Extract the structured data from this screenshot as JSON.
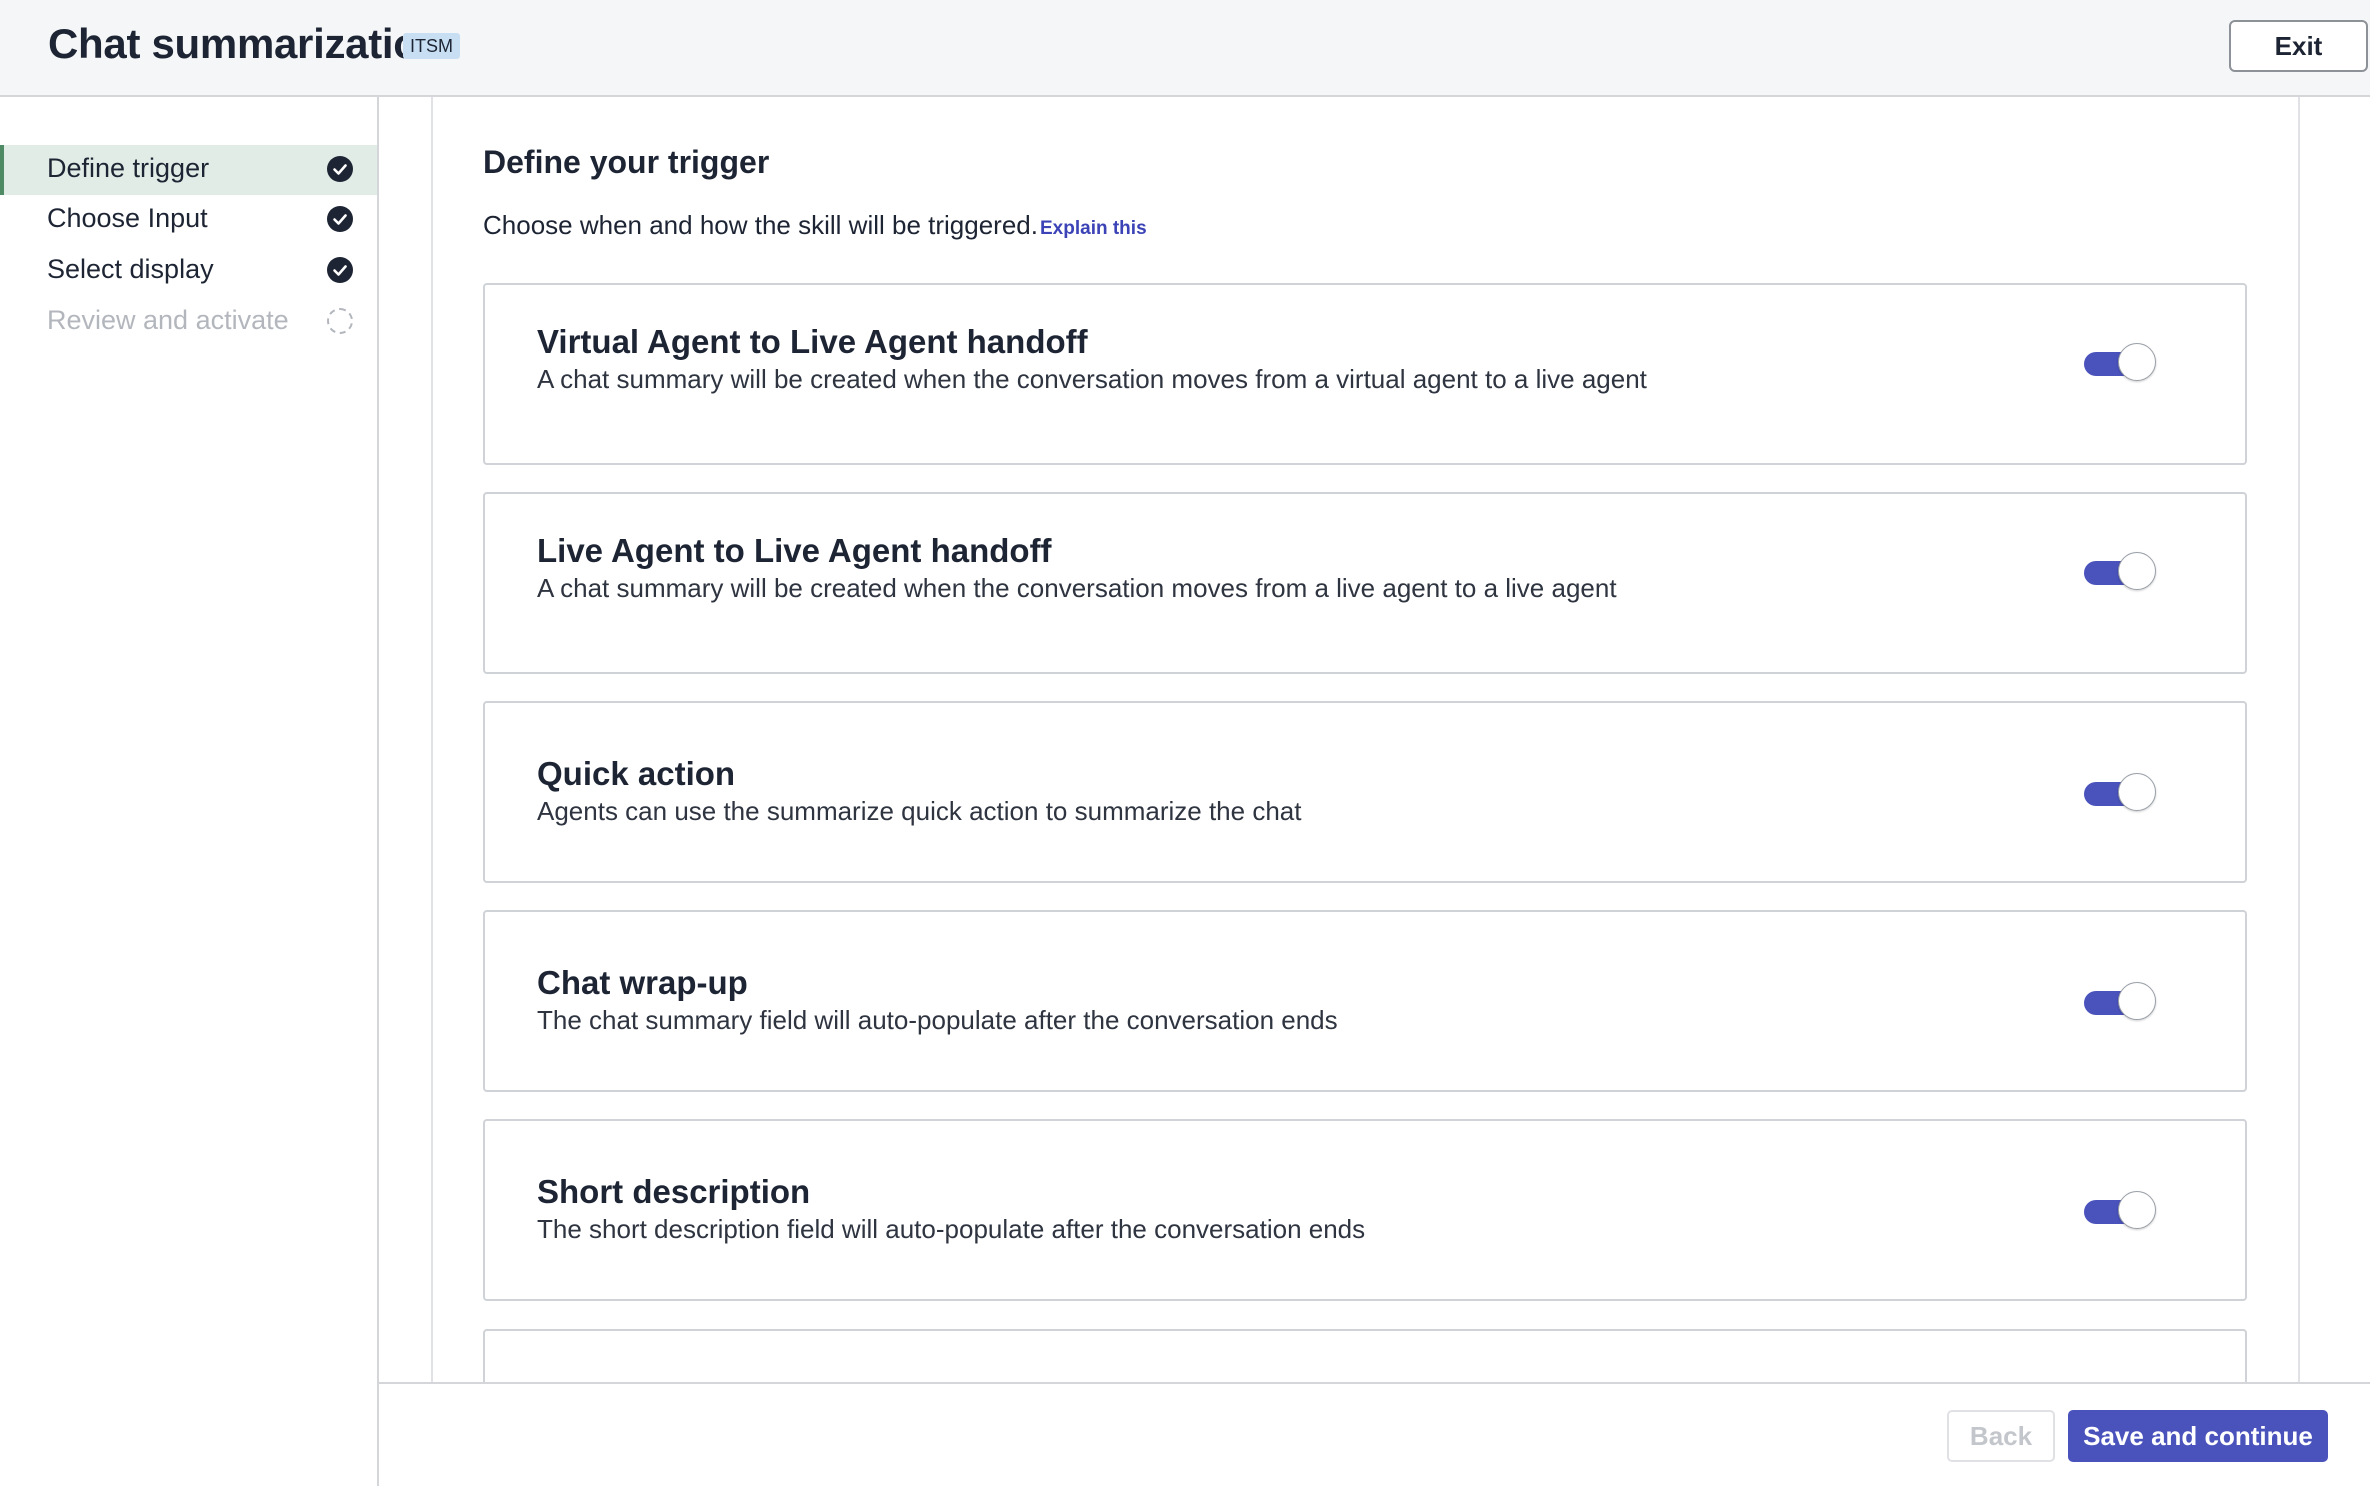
{
  "header": {
    "title": "Chat summarization",
    "badge": "ITSM",
    "exit_label": "Exit"
  },
  "sidebar": {
    "steps": [
      {
        "label": "Define trigger",
        "status": "complete",
        "active": true
      },
      {
        "label": "Choose Input",
        "status": "complete",
        "active": false
      },
      {
        "label": "Select display",
        "status": "complete",
        "active": false
      },
      {
        "label": "Review and activate",
        "status": "pending",
        "active": false
      }
    ]
  },
  "main": {
    "title": "Define your trigger",
    "subtitle": "Choose when and how the skill will be triggered.",
    "explain_link": "Explain this",
    "cards": [
      {
        "title": "Virtual Agent to Live Agent handoff",
        "description": "A chat summary will be created when the conversation moves from a virtual agent to a live agent",
        "enabled": true
      },
      {
        "title": "Live Agent to Live Agent handoff",
        "description": "A chat summary will be created when the conversation moves from a live agent to a live agent",
        "enabled": true
      },
      {
        "title": "Quick action",
        "description": "Agents can use the summarize quick action to summarize the chat",
        "enabled": true
      },
      {
        "title": "Chat wrap-up",
        "description": "The chat summary field will auto-populate after the conversation ends",
        "enabled": true
      },
      {
        "title": "Short description",
        "description": "The short description field will auto-populate after the conversation ends",
        "enabled": true
      }
    ]
  },
  "footer": {
    "back_label": "Back",
    "save_label": "Save and continue"
  },
  "colors": {
    "accent": "#4a52bc",
    "active_step_bg": "#e1ece6",
    "active_step_border": "#4e8b64",
    "badge_bg": "#c8dff3"
  }
}
